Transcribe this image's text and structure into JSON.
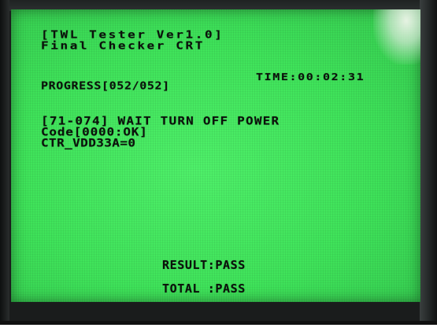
{
  "screen": {
    "title_line1": "[TWL Tester Ver1.0]",
    "title_line2": "Final Checker CRT",
    "time": "TIME:00:02:31",
    "progress": "PROGRESS[052/052]",
    "status_line": "[71-074] WAIT TURN OFF POWER",
    "code_line": "Code[0000:OK]",
    "ctr_line": "CTR_VDD33A=0",
    "result": "RESULT:PASS",
    "total": "TOTAL  :PASS"
  },
  "colors": {
    "screen_green": "#3fe35a",
    "text": "#0b110b",
    "bezel": "#1a1c1c"
  }
}
